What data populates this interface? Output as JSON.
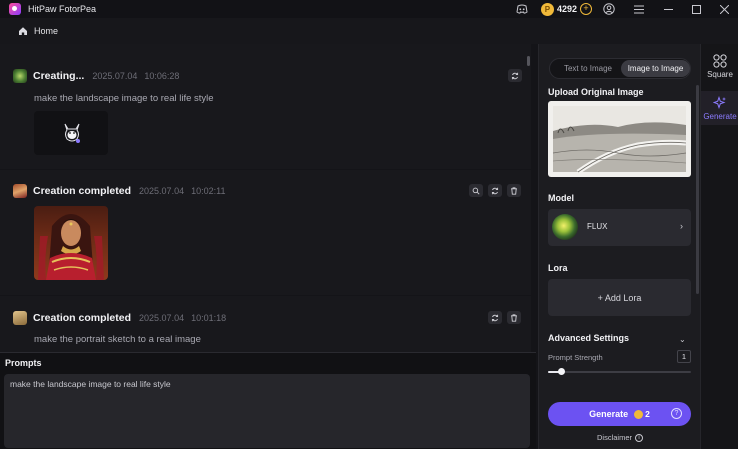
{
  "app": {
    "title": "HitPaw FotorPea",
    "coins": "4292"
  },
  "nav": {
    "home": "Home"
  },
  "feed": [
    {
      "status": "Creating...",
      "date": "2025.07.04",
      "time": "10:06:28",
      "prompt": "make the landscape image to real life style"
    },
    {
      "status": "Creation completed",
      "date": "2025.07.04",
      "time": "10:02:11",
      "prompt": ""
    },
    {
      "status": "Creation completed",
      "date": "2025.07.04",
      "time": "10:01:18",
      "prompt": "make the portrait sketch to a real image"
    }
  ],
  "prompts": {
    "title": "Prompts",
    "value": "make the landscape image to real life style"
  },
  "panel": {
    "tabs": [
      "Text to Image",
      "Image to Image"
    ],
    "active_tab": "Image to Image",
    "upload_title": "Upload Original Image",
    "model_title": "Model",
    "model_name": "FLUX",
    "lora_title": "Lora",
    "lora_add": "+ Add Lora",
    "advanced_title": "Advanced Settings",
    "prompt_strength_label": "Prompt Strength",
    "prompt_strength_value": "1",
    "prompt_strength_level": 0.09,
    "generate_label": "Generate",
    "generate_cost": "2",
    "disclaimer": "Disclaimer"
  },
  "sidenav": [
    {
      "label": "Square",
      "icon": "square-grid-icon",
      "active": false
    },
    {
      "label": "Generate",
      "icon": "sparkle-icon",
      "active": true
    }
  ],
  "colors": {
    "accent": "#6c52f2",
    "coin": "#f0b93a",
    "active_nav": "#8c7bff"
  }
}
